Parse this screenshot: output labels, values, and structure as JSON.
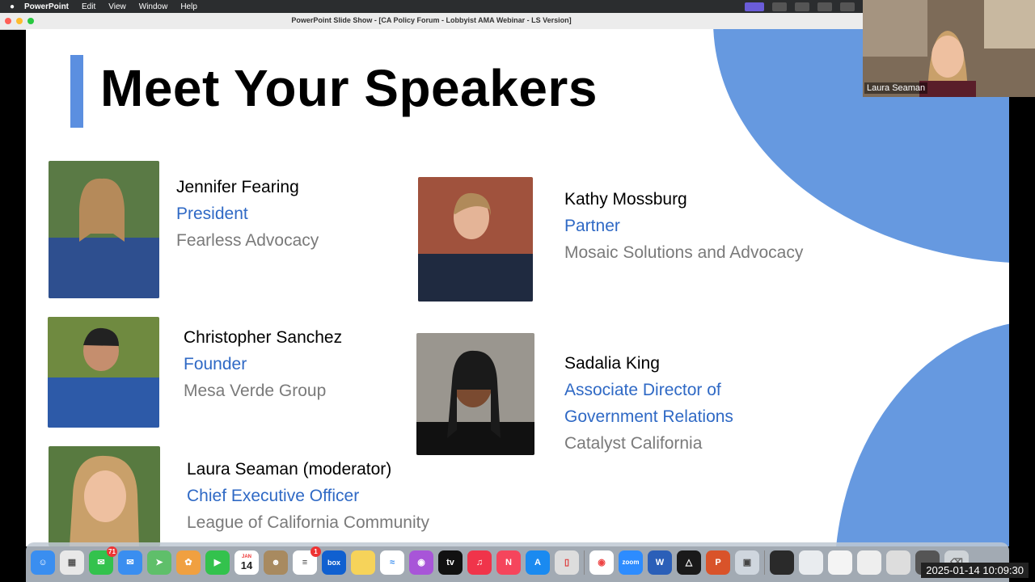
{
  "menubar": {
    "app_name": "PowerPoint",
    "items": [
      "Edit",
      "View",
      "Window",
      "Help"
    ]
  },
  "window": {
    "title": "PowerPoint Slide Show - [CA Policy Forum - Lobbyist AMA Webinar  -  LS Version]"
  },
  "slide": {
    "title": "Meet Your Speakers",
    "speakers": [
      {
        "name": "Jennifer Fearing",
        "role": "President",
        "org": "Fearless Advocacy"
      },
      {
        "name": "Kathy Mossburg",
        "role": "Partner",
        "org": "Mosaic Solutions and Advocacy"
      },
      {
        "name": "Christopher Sanchez",
        "role": "Founder",
        "org": "Mesa Verde Group"
      },
      {
        "name": "Sadalia King",
        "role_line1": "Associate Director of",
        "role_line2": "Government Relations",
        "org": "Catalyst California"
      },
      {
        "name": "Laura Seaman (moderator)",
        "role": "Chief Executive Officer",
        "org": "League of California Community"
      }
    ]
  },
  "video": {
    "participant_name": "Laura Seaman"
  },
  "dock": {
    "messages_badge": "71",
    "reminders_badge": "1",
    "calendar_month": "JAN",
    "calendar_day": "14",
    "box_label": "box",
    "zoom_label": "zoom"
  },
  "timestamp": "2025-01-14 10:09:30",
  "colors": {
    "accent_blue": "#5b8fe0",
    "role_blue": "#2f69c5",
    "org_gray": "#7a7a7a"
  }
}
